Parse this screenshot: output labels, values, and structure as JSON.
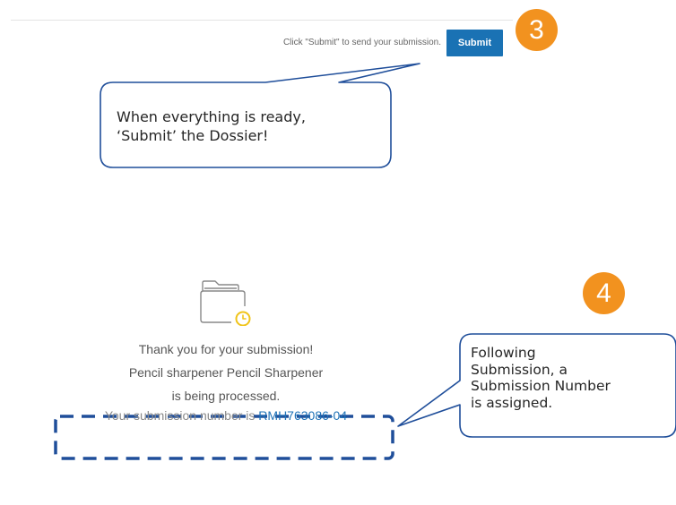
{
  "toolbar": {
    "hint": "Click \"Submit\" to send your submission.",
    "submit_label": "Submit"
  },
  "steps": {
    "step3": "3",
    "step4": "4"
  },
  "callouts": {
    "submit_callout": [
      "When everything is ready,",
      "‘Submit’ the Dossier!"
    ],
    "number_callout": [
      "Following",
      "Submission, a",
      "Submission Number",
      "is assigned."
    ]
  },
  "confirmation": {
    "thanks": "Thank you for your submission!",
    "product": "Pencil sharpener Pencil Sharpener",
    "processing": "is being processed.",
    "number_prefix": "Your submission number is ",
    "number": "RMH763086-04"
  },
  "icons": {
    "folder": "folder-clock-icon",
    "clock_color": "#f0c419"
  },
  "colors": {
    "badge": "#f2921f",
    "button": "#1a72b4",
    "callout_border": "#1f4e9a",
    "link": "#1f73b7"
  }
}
